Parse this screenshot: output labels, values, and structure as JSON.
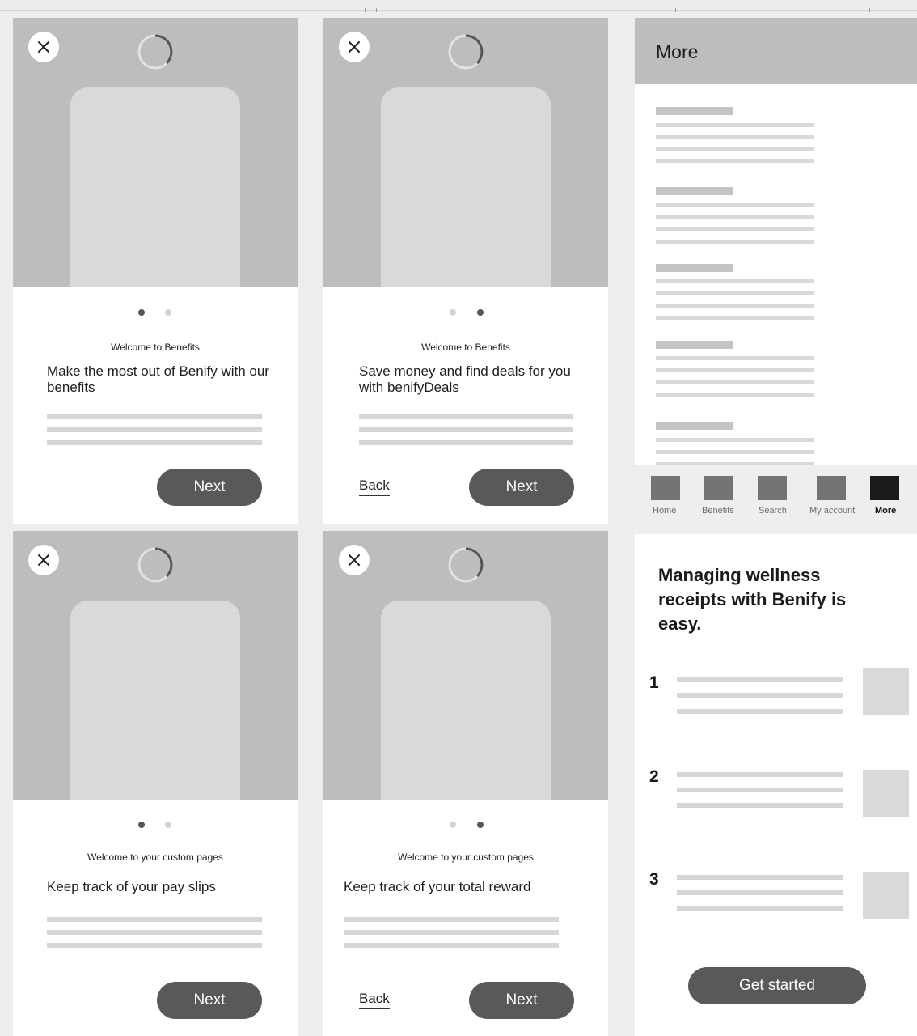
{
  "onboarding": {
    "cards": [
      {
        "kicker": "Welcome to Benefits",
        "headline": "Make the most out of Benify with our benefits",
        "next": "Next",
        "back": "",
        "active_dot": 0
      },
      {
        "kicker": "Welcome to Benefits",
        "headline": "Save money and find deals for you with benifyDeals",
        "next": "Next",
        "back": "Back",
        "active_dot": 1
      },
      {
        "kicker": "Welcome to your custom pages",
        "headline": "Keep track of your pay slips",
        "next": "Next",
        "back": "",
        "active_dot": 0
      },
      {
        "kicker": "Welcome to your custom pages",
        "headline": "Keep track of your total reward",
        "next": "Next",
        "back": "Back",
        "active_dot": 1
      }
    ]
  },
  "more": {
    "title": "More",
    "tabs": [
      {
        "label": "Home",
        "active": false
      },
      {
        "label": "Benefits",
        "active": false
      },
      {
        "label": "Search",
        "active": false
      },
      {
        "label": "My account",
        "active": false
      },
      {
        "label": "More",
        "active": true
      }
    ]
  },
  "wellness": {
    "title": "Managing wellness receipts with Benify is easy.",
    "steps": [
      "1",
      "2",
      "3"
    ],
    "cta": "Get started"
  },
  "colors": {
    "placeholder": "#bdbdbd",
    "phone": "#d9d9d9",
    "button": "#595959",
    "active_tab": "#1a1a1a",
    "dot_active": "#555555",
    "dot_inactive": "#d3d3d3"
  },
  "icons": {
    "close": "close-icon",
    "spinner": "loading-spinner-icon"
  }
}
